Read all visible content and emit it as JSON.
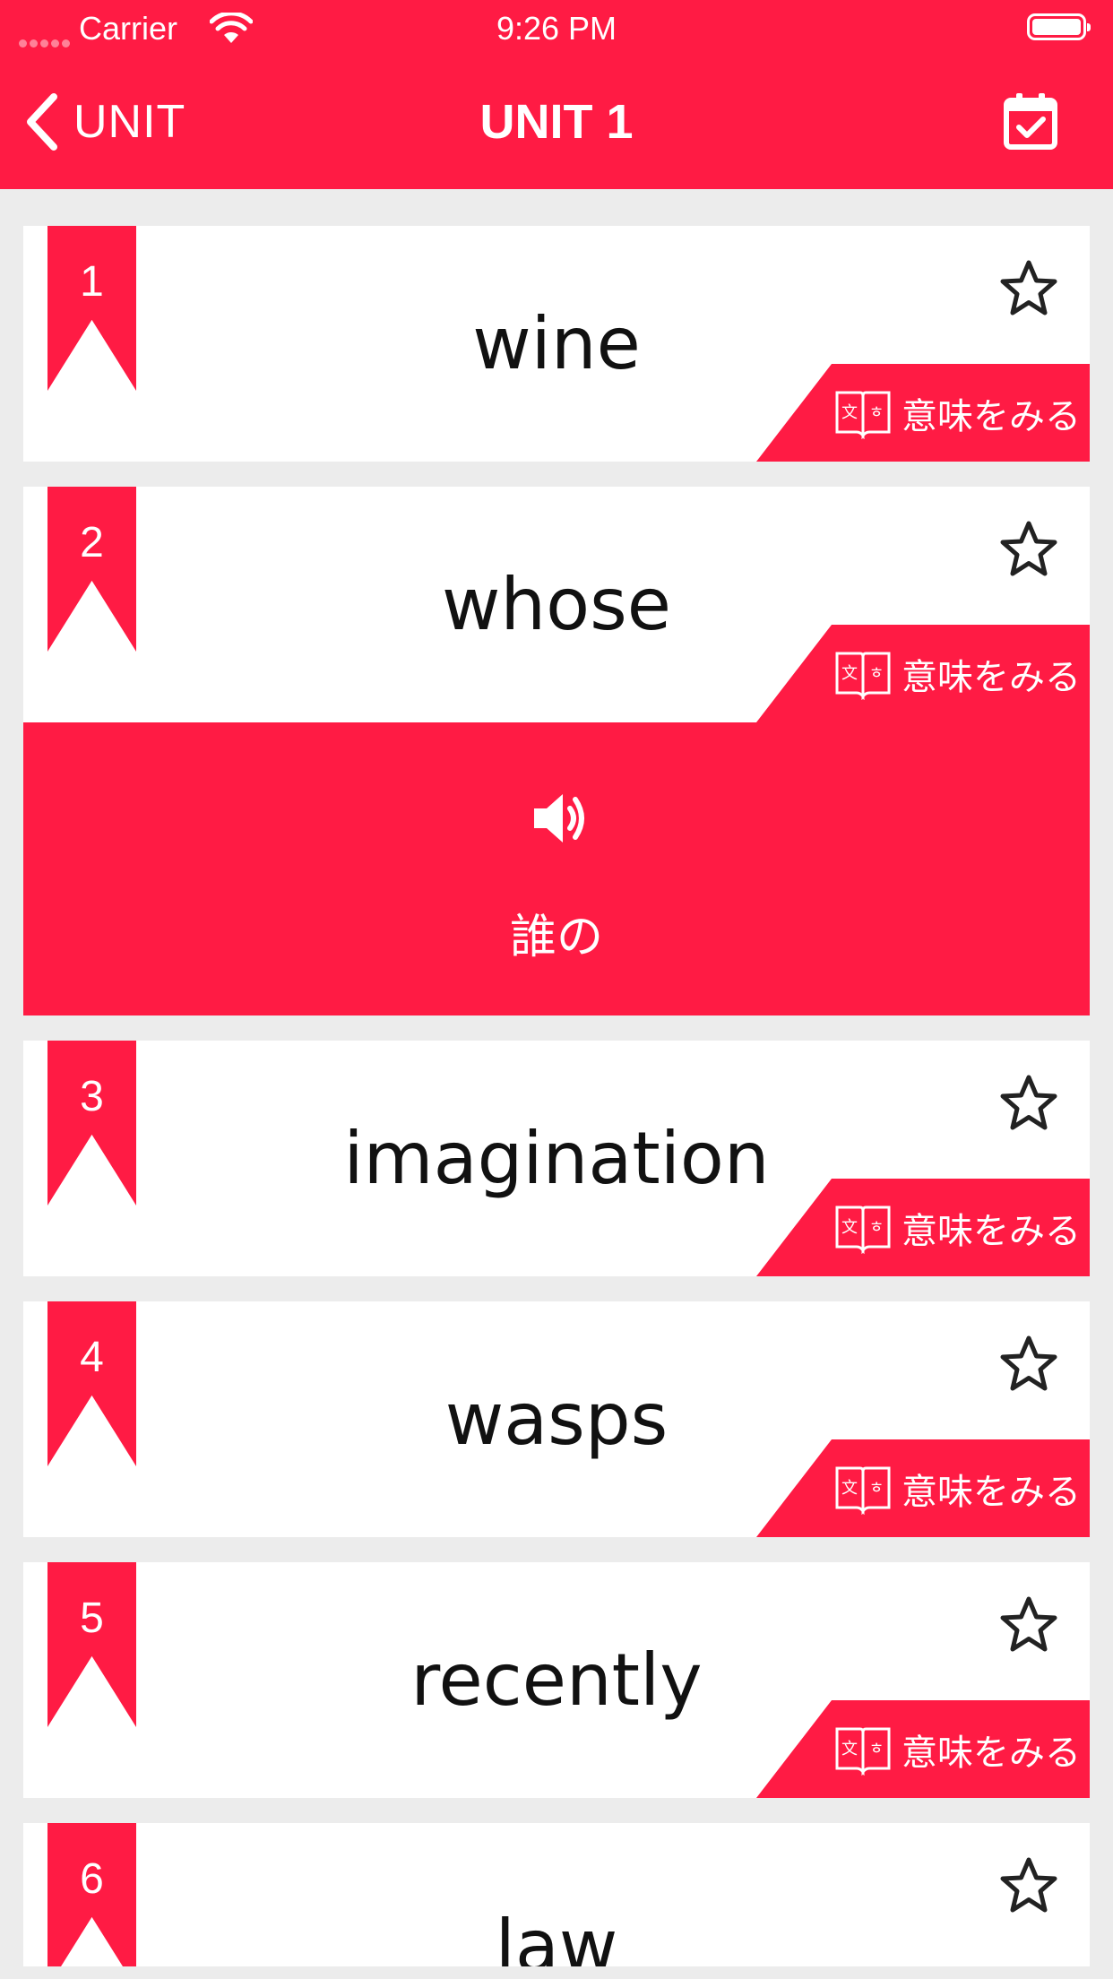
{
  "status_bar": {
    "carrier": "Carrier",
    "time": "9:26 PM"
  },
  "nav": {
    "back_label": "UNIT",
    "title": "UNIT 1"
  },
  "colors": {
    "accent": "#ff1b44",
    "background": "#ececec",
    "card": "#ffffff"
  },
  "meaning_button_label": "意味をみる",
  "words": [
    {
      "number": "1",
      "word": "wine",
      "starred": false
    },
    {
      "number": "2",
      "word": "whose",
      "starred": false,
      "expanded": true,
      "translation": "誰の"
    },
    {
      "number": "3",
      "word": "imagination",
      "starred": false
    },
    {
      "number": "4",
      "word": "wasps",
      "starred": false
    },
    {
      "number": "5",
      "word": "recently",
      "starred": false
    },
    {
      "number": "6",
      "word": "law",
      "starred": false
    }
  ],
  "icons": {
    "back": "chevron-left-icon",
    "calendar": "calendar-check-icon",
    "star": "star-outline-icon",
    "dictionary": "dictionary-book-icon",
    "speaker": "speaker-icon"
  }
}
